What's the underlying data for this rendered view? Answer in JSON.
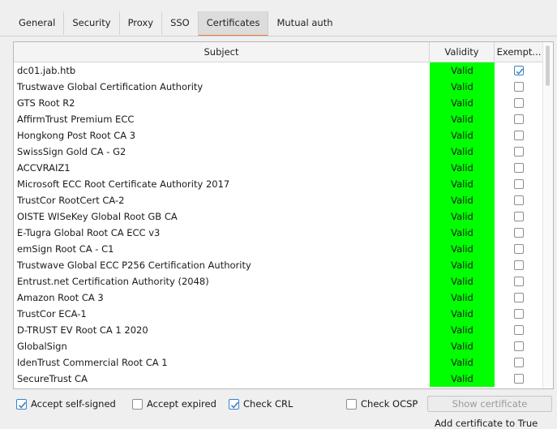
{
  "tabs": [
    {
      "label": "General"
    },
    {
      "label": "Security"
    },
    {
      "label": "Proxy"
    },
    {
      "label": "SSO"
    },
    {
      "label": "Certificates"
    },
    {
      "label": "Mutual auth"
    }
  ],
  "table": {
    "headers": {
      "subject": "Subject",
      "validity": "Validity",
      "exempt": "Exempt..."
    },
    "rows": [
      {
        "subject": "dc01.jab.htb",
        "validity": "Valid",
        "exempt": true
      },
      {
        "subject": "Trustwave Global Certification Authority",
        "validity": "Valid",
        "exempt": false
      },
      {
        "subject": "GTS Root R2",
        "validity": "Valid",
        "exempt": false
      },
      {
        "subject": "AffirmTrust Premium ECC",
        "validity": "Valid",
        "exempt": false
      },
      {
        "subject": "Hongkong Post Root CA 3",
        "validity": "Valid",
        "exempt": false
      },
      {
        "subject": "SwissSign Gold CA - G2",
        "validity": "Valid",
        "exempt": false
      },
      {
        "subject": "ACCVRAIZ1",
        "validity": "Valid",
        "exempt": false
      },
      {
        "subject": "Microsoft ECC Root Certificate Authority 2017",
        "validity": "Valid",
        "exempt": false
      },
      {
        "subject": "TrustCor RootCert CA-2",
        "validity": "Valid",
        "exempt": false
      },
      {
        "subject": "OISTE WISeKey Global Root GB CA",
        "validity": "Valid",
        "exempt": false
      },
      {
        "subject": "E-Tugra Global Root CA ECC v3",
        "validity": "Valid",
        "exempt": false
      },
      {
        "subject": "emSign Root CA - C1",
        "validity": "Valid",
        "exempt": false
      },
      {
        "subject": "Trustwave Global ECC P256 Certification Authority",
        "validity": "Valid",
        "exempt": false
      },
      {
        "subject": "Entrust.net Certification Authority (2048)",
        "validity": "Valid",
        "exempt": false
      },
      {
        "subject": "Amazon Root CA 3",
        "validity": "Valid",
        "exempt": false
      },
      {
        "subject": "TrustCor ECA-1",
        "validity": "Valid",
        "exempt": false
      },
      {
        "subject": "D-TRUST EV Root CA 1 2020",
        "validity": "Valid",
        "exempt": false
      },
      {
        "subject": "GlobalSign",
        "validity": "Valid",
        "exempt": false
      },
      {
        "subject": "IdenTrust Commercial Root CA 1",
        "validity": "Valid",
        "exempt": false
      },
      {
        "subject": "SecureTrust CA",
        "validity": "Valid",
        "exempt": false
      }
    ]
  },
  "options": {
    "accept_self_signed": {
      "label": "Accept self-signed",
      "checked": true
    },
    "accept_expired": {
      "label": "Accept expired",
      "checked": false
    },
    "check_crl": {
      "label": "Check CRL",
      "checked": true
    },
    "check_ocsp": {
      "label": "Check OCSP",
      "checked": false
    }
  },
  "buttons": {
    "show_certificate": "Show certificate"
  },
  "footer": {
    "cut_text": "Add certificate to True"
  },
  "colors": {
    "valid_bg": "#00ff00",
    "active_tab_accent": "#f07d3c",
    "checkbox_accent": "#3a82c4"
  }
}
